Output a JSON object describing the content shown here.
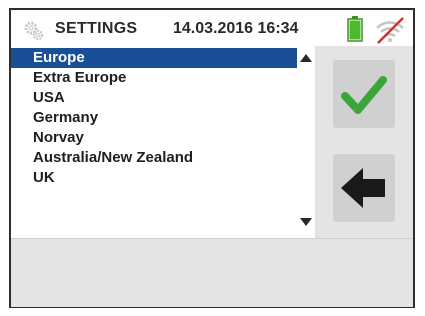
{
  "header": {
    "title": "SETTINGS",
    "datetime": "14.03.2016  16:34",
    "settings_icon": "gear-icon",
    "battery_icon": "battery-icon",
    "battery_level": 1.0,
    "battery_color": "#4cb92f",
    "signal_icon": "wifi-off-icon",
    "signal_strike_color": "#e02a2a"
  },
  "list": {
    "items": [
      {
        "label": "Europe",
        "selected": true
      },
      {
        "label": "Extra Europe",
        "selected": false
      },
      {
        "label": "USA",
        "selected": false
      },
      {
        "label": "Germany",
        "selected": false
      },
      {
        "label": "Norvay",
        "selected": false
      },
      {
        "label": "Australia/New Zealand",
        "selected": false
      },
      {
        "label": "UK",
        "selected": false
      }
    ],
    "selection_color": "#1a4e96"
  },
  "scrollbar": {
    "up_icon": "triangle-up-icon",
    "down_icon": "triangle-down-icon"
  },
  "actions": {
    "confirm_icon": "checkmark-icon",
    "confirm_color": "#3aa63a",
    "back_icon": "arrow-left-icon"
  }
}
